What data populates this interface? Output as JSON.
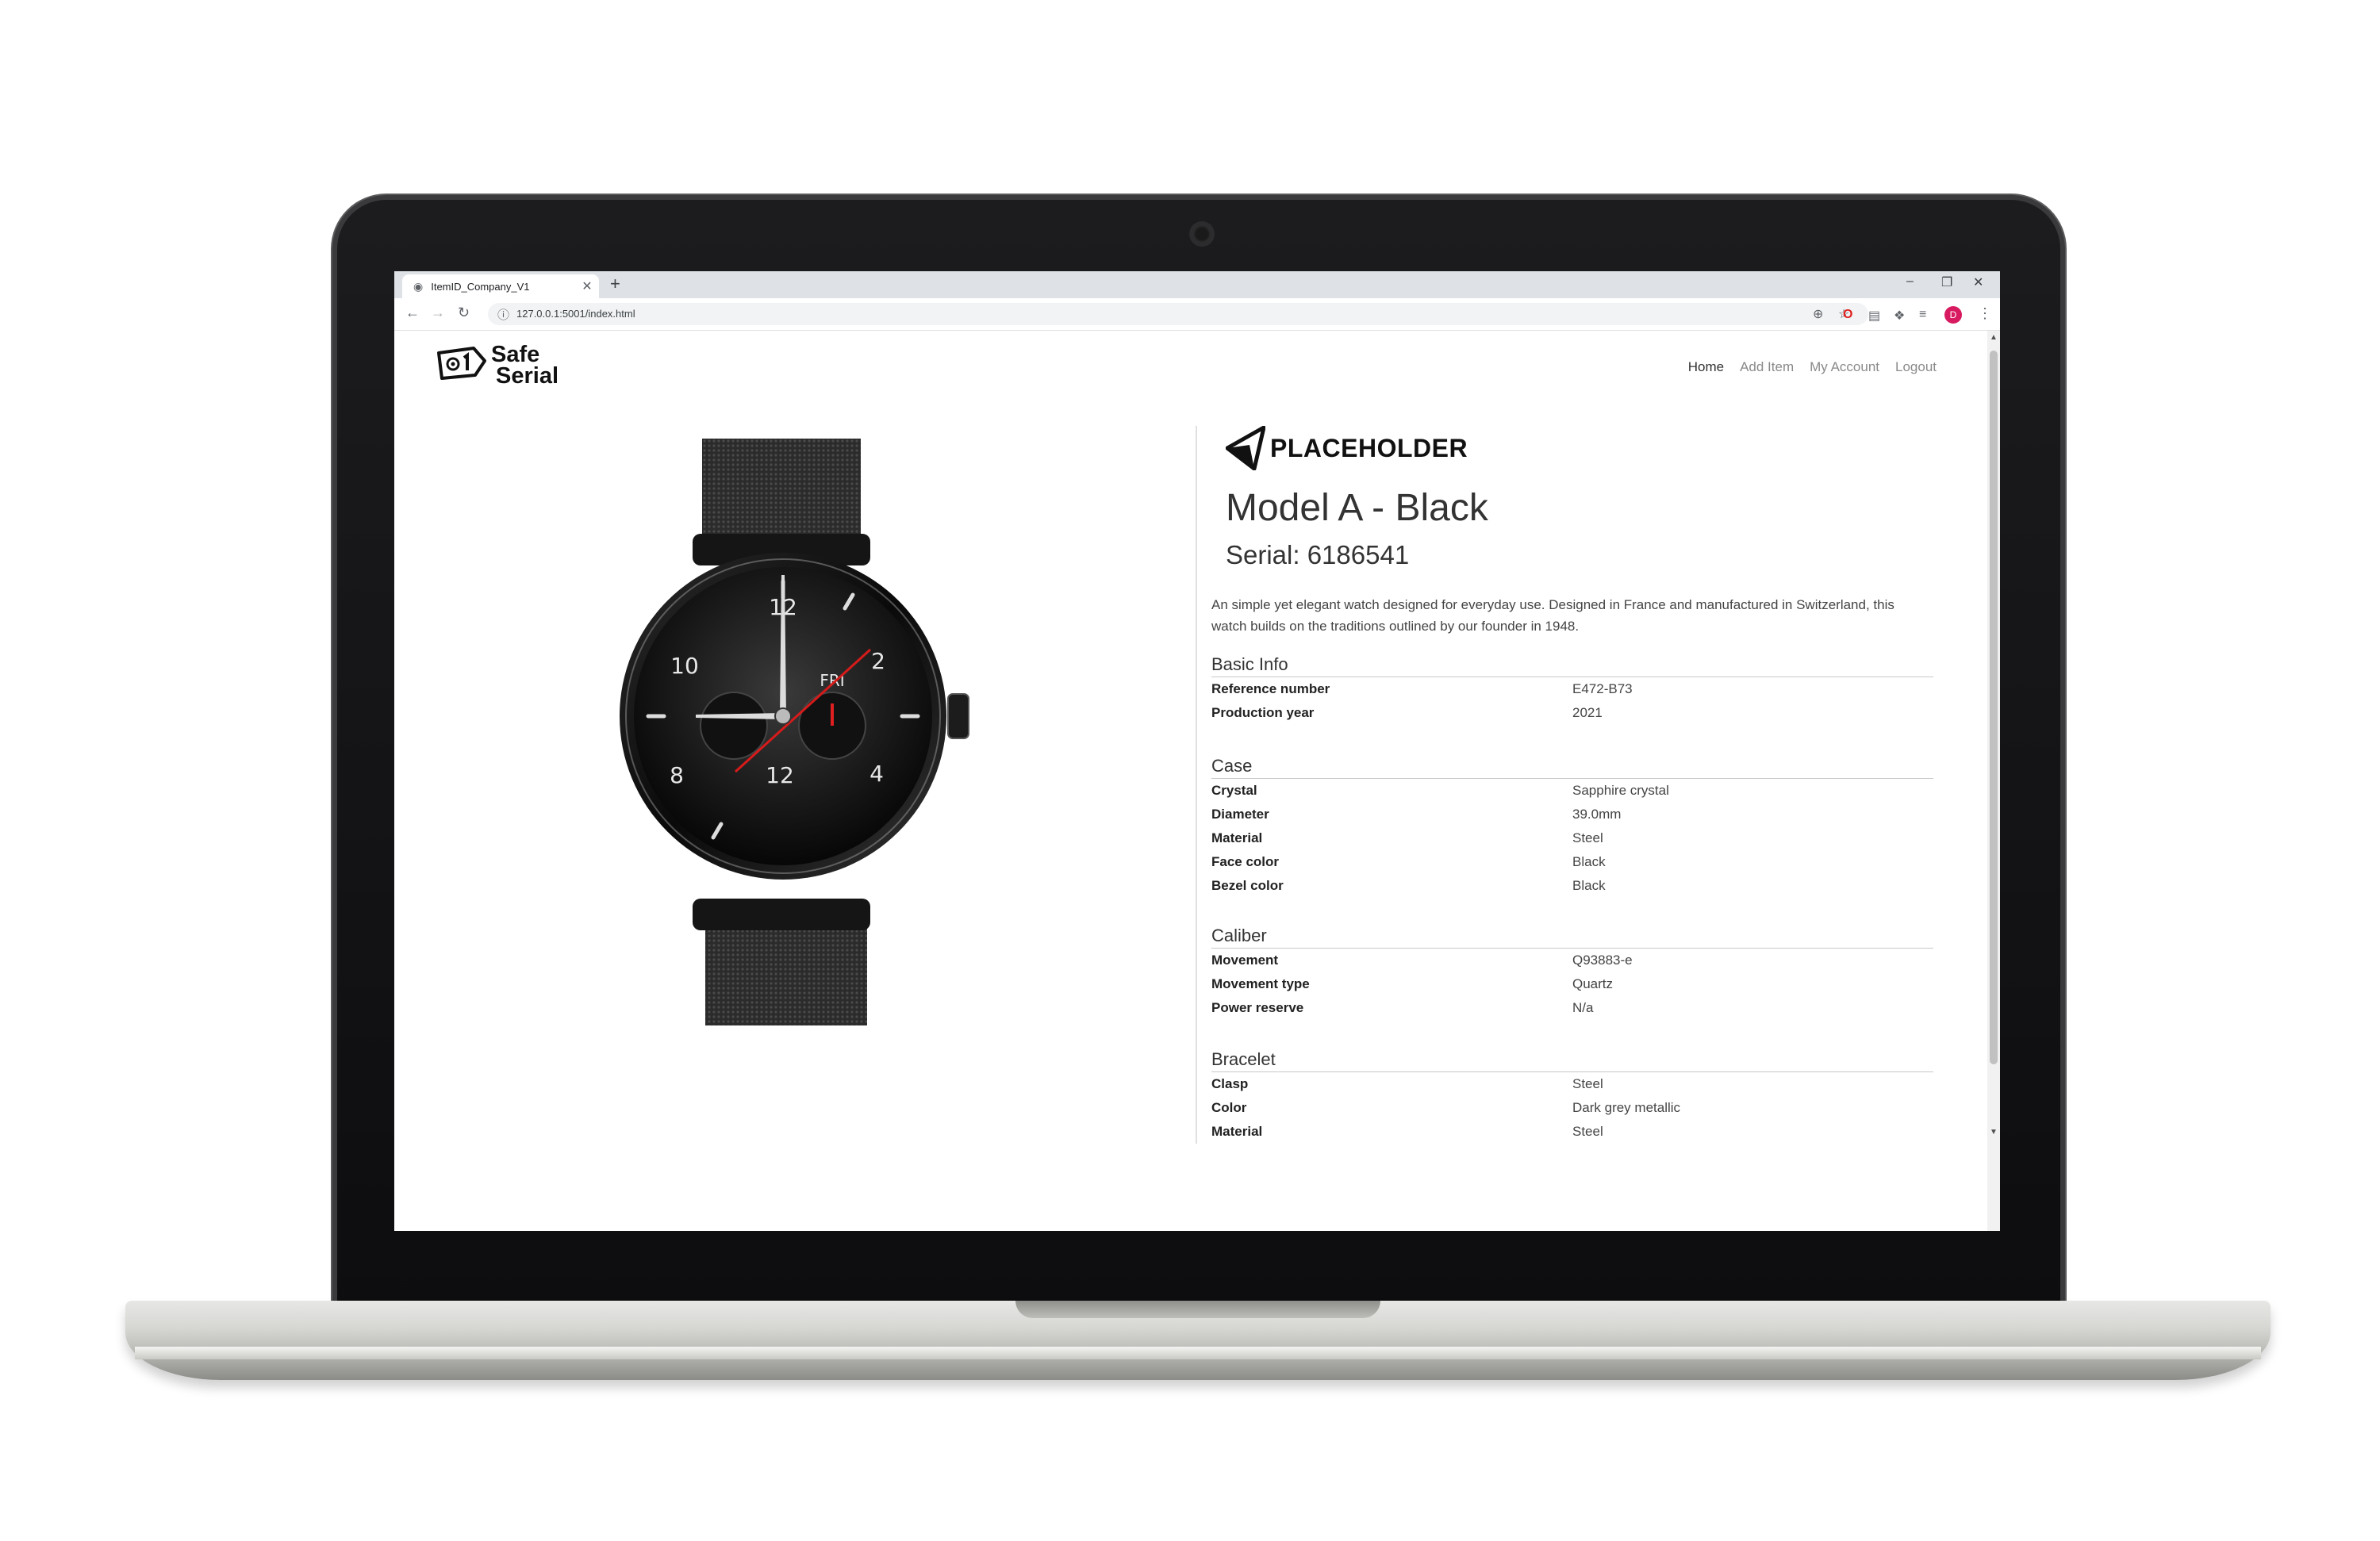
{
  "browser": {
    "tab_title": "ItemID_Company_V1",
    "url": "127.0.0.1:5001/index.html",
    "avatar_letter": "D"
  },
  "site": {
    "brand_line1": "Safe",
    "brand_line2": "Serial",
    "nav": [
      "Home",
      "Add Item",
      "My Account",
      "Logout"
    ]
  },
  "product": {
    "manufacturer": "PLACEHOLDER",
    "model": "Model A - Black",
    "serial": "Serial: 6186541",
    "description": "An simple yet elegant watch designed for everyday use. Designed in France and manufactured in Switzerland, this watch builds on the traditions outlined by our founder in 1948.",
    "watch_dial": {
      "numerals": [
        "12",
        "2",
        "4",
        "12",
        "8",
        "10"
      ],
      "day": "FRI"
    },
    "sections": [
      {
        "title": "Basic Info",
        "rows": [
          {
            "key": "Reference number",
            "value": "E472-B73"
          },
          {
            "key": "Production year",
            "value": "2021"
          }
        ]
      },
      {
        "title": "Case",
        "rows": [
          {
            "key": "Crystal",
            "value": "Sapphire crystal"
          },
          {
            "key": "Diameter",
            "value": "39.0mm"
          },
          {
            "key": "Material",
            "value": "Steel"
          },
          {
            "key": "Face color",
            "value": "Black"
          },
          {
            "key": "Bezel color",
            "value": "Black"
          }
        ]
      },
      {
        "title": "Caliber",
        "rows": [
          {
            "key": "Movement",
            "value": "Q93883-e"
          },
          {
            "key": "Movement type",
            "value": "Quartz"
          },
          {
            "key": "Power reserve",
            "value": "N/a"
          }
        ]
      },
      {
        "title": "Bracelet",
        "rows": [
          {
            "key": "Clasp",
            "value": "Steel"
          },
          {
            "key": "Color",
            "value": "Dark grey metallic"
          },
          {
            "key": "Material",
            "value": "Steel"
          }
        ]
      }
    ]
  },
  "colors": {
    "bezel": "#111113",
    "brand_avatar": "#d81b60",
    "text_dark": "#333333",
    "nav_muted": "#8a8a8a"
  }
}
